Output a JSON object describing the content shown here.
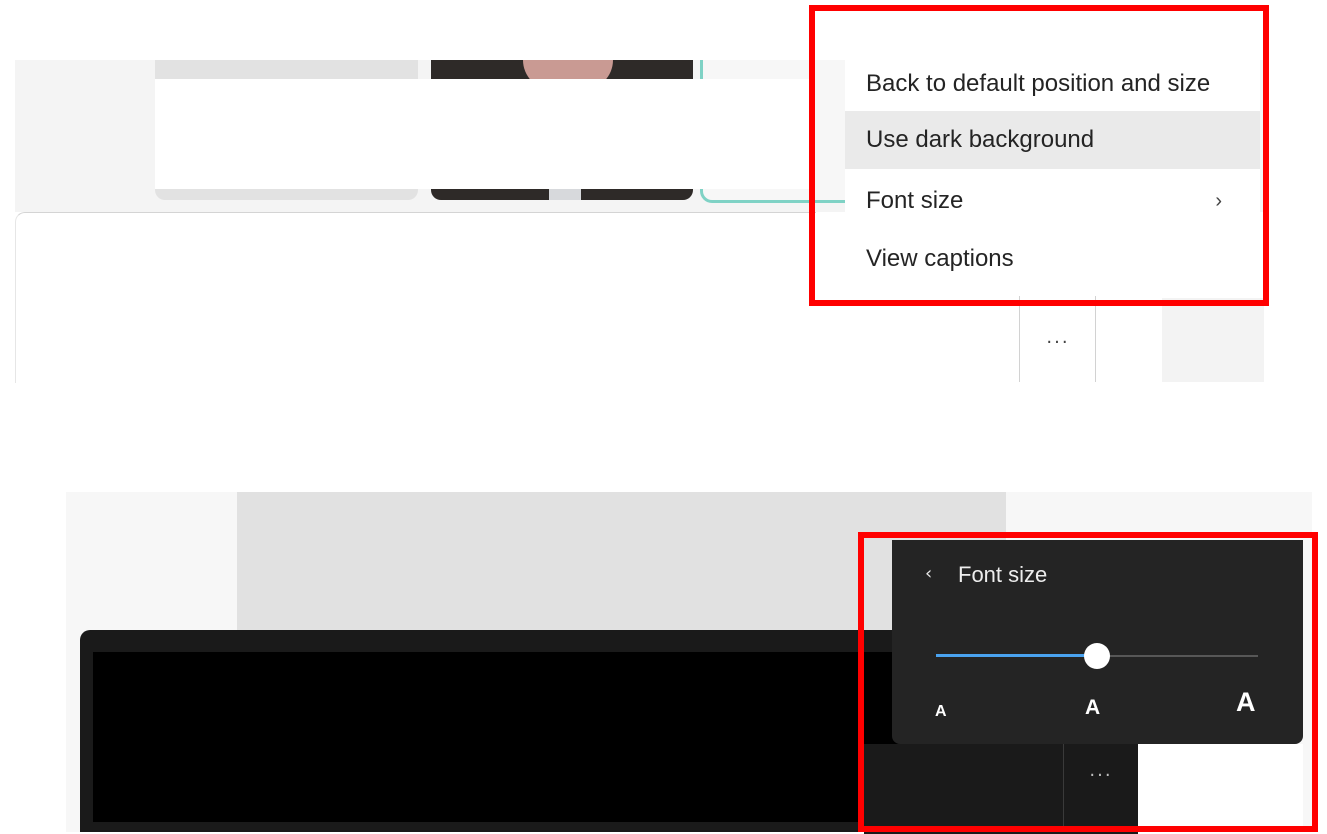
{
  "top": {
    "menu": {
      "items": [
        {
          "label": "Back to default position and size",
          "hovered": false,
          "has_submenu": false
        },
        {
          "label": "Use dark background",
          "hovered": true,
          "has_submenu": false
        },
        {
          "label": "Font size",
          "hovered": false,
          "has_submenu": true
        },
        {
          "label": "View captions",
          "hovered": false,
          "has_submenu": false
        }
      ],
      "submenu_chevron": "›"
    },
    "more_button": "..."
  },
  "bottom": {
    "font_size_menu": {
      "back_icon": "‹",
      "title": "Font size",
      "slider_value": 0.5,
      "labels": {
        "small": "A",
        "medium": "A",
        "large": "A"
      }
    },
    "more_button": "..."
  },
  "colors": {
    "highlight": "#ff0000",
    "slider_accent": "#4aa3f0",
    "dark_menu": "#242424"
  }
}
